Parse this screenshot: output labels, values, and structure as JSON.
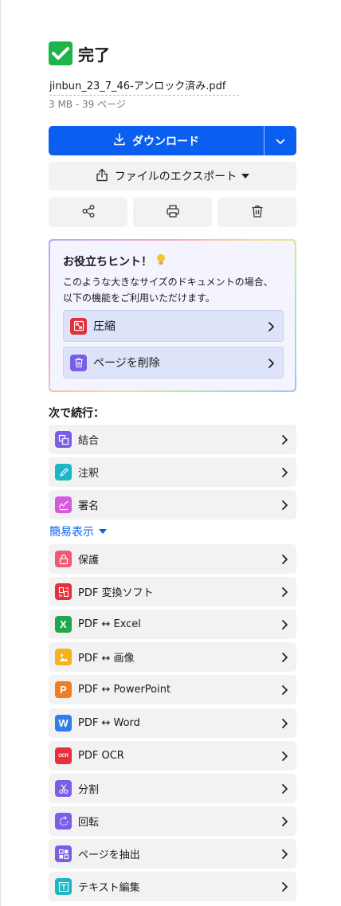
{
  "status": {
    "title": "完了",
    "check_color": "#1db54a"
  },
  "file": {
    "name": "jinbun_23_7_46-アンロック済み.pdf",
    "meta": "3 MB - 39 ページ"
  },
  "download": {
    "label": "ダウンロード",
    "color": "#0a5ff0",
    "icon": "download-icon",
    "caret_icon": "chevron-down-icon"
  },
  "export": {
    "label": "ファイルのエクスポート",
    "icon": "export-icon"
  },
  "actions": [
    {
      "name": "share",
      "icon": "share-icon"
    },
    {
      "name": "print",
      "icon": "print-icon"
    },
    {
      "name": "delete",
      "icon": "trash-icon"
    }
  ],
  "hint": {
    "title": "お役立ちヒント！",
    "text": "このような大きなサイズのドキュメントの場合、以下の機能をご利用いただけます。",
    "items": [
      {
        "label": "圧縮",
        "icon": "compress-icon",
        "color": "#e0303c"
      },
      {
        "label": "ページを削除",
        "icon": "trash-icon",
        "color": "#7b5ee8"
      }
    ]
  },
  "continue_label": "次で続行：",
  "tools_top": [
    {
      "label": "結合",
      "icon": "merge-icon",
      "color": "#7b5ee8"
    },
    {
      "label": "注釈",
      "icon": "annotate-icon",
      "color": "#1bb7c4"
    },
    {
      "label": "署名",
      "icon": "sign-icon",
      "color": "#d958e0"
    }
  ],
  "simple_view": "簡易表示",
  "tools_more": [
    {
      "label": "保護",
      "icon": "lock-icon",
      "color": "#f05a78"
    },
    {
      "label": "PDF 変換ソフト",
      "icon": "convert-icon",
      "color": "#e8303a"
    },
    {
      "label": "PDF ↔ Excel",
      "icon": "excel-icon",
      "color": "#21a84a",
      "glyph": "X"
    },
    {
      "label": "PDF ↔ 画像",
      "icon": "image-icon",
      "color": "#f5b21a"
    },
    {
      "label": "PDF ↔ PowerPoint",
      "icon": "powerpoint-icon",
      "color": "#f07d22",
      "glyph": "P"
    },
    {
      "label": "PDF ↔ Word",
      "icon": "word-icon",
      "color": "#2f7de8",
      "glyph": "W"
    },
    {
      "label": "PDF OCR",
      "icon": "ocr-icon",
      "color": "#e8303a",
      "glyph": "OCR"
    },
    {
      "label": "分割",
      "icon": "split-icon",
      "color": "#7b5ee8"
    },
    {
      "label": "回転",
      "icon": "rotate-icon",
      "color": "#7b5ee8"
    },
    {
      "label": "ページを抽出",
      "icon": "extract-icon",
      "color": "#7b5ee8"
    },
    {
      "label": "テキスト編集",
      "icon": "edit-text-icon",
      "color": "#1bb7c4"
    }
  ]
}
